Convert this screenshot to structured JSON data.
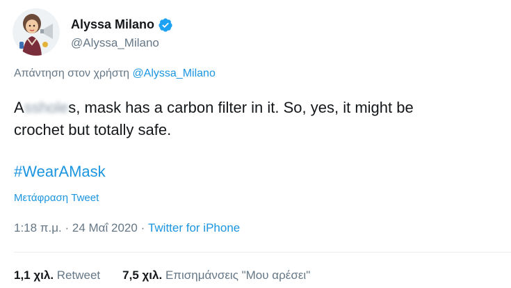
{
  "colors": {
    "link": "#1b95e0",
    "secondary_text": "#657786",
    "primary_text": "#14171a",
    "verified_badge": "#1da1f2"
  },
  "author": {
    "display_name": "Alyssa Milano",
    "handle": "@Alyssa_Milano",
    "verified_icon": "verified-badge-icon"
  },
  "reply": {
    "prefix": "Απάντηση στον χρήστη",
    "target_handle": "@Alyssa_Milano"
  },
  "tweet": {
    "text_start": "A",
    "text_blurred": "sshole",
    "text_rest_line1": "s, mask has a carbon filter in it. So, yes, it might be",
    "text_line2": "crochet but totally safe.",
    "hashtag": "#WearAMask",
    "translate_label": "Μετάφραση Tweet"
  },
  "meta": {
    "time": "1:18 π.μ.",
    "separator": " · ",
    "date": "24 Μαΐ 2020",
    "source": "Twitter for iPhone"
  },
  "stats": {
    "retweets_count": "1,1 χιλ.",
    "retweets_label": "Retweet",
    "likes_count": "7,5 χιλ.",
    "likes_label": "Επισημάνσεις \"Μου αρέσει\""
  }
}
